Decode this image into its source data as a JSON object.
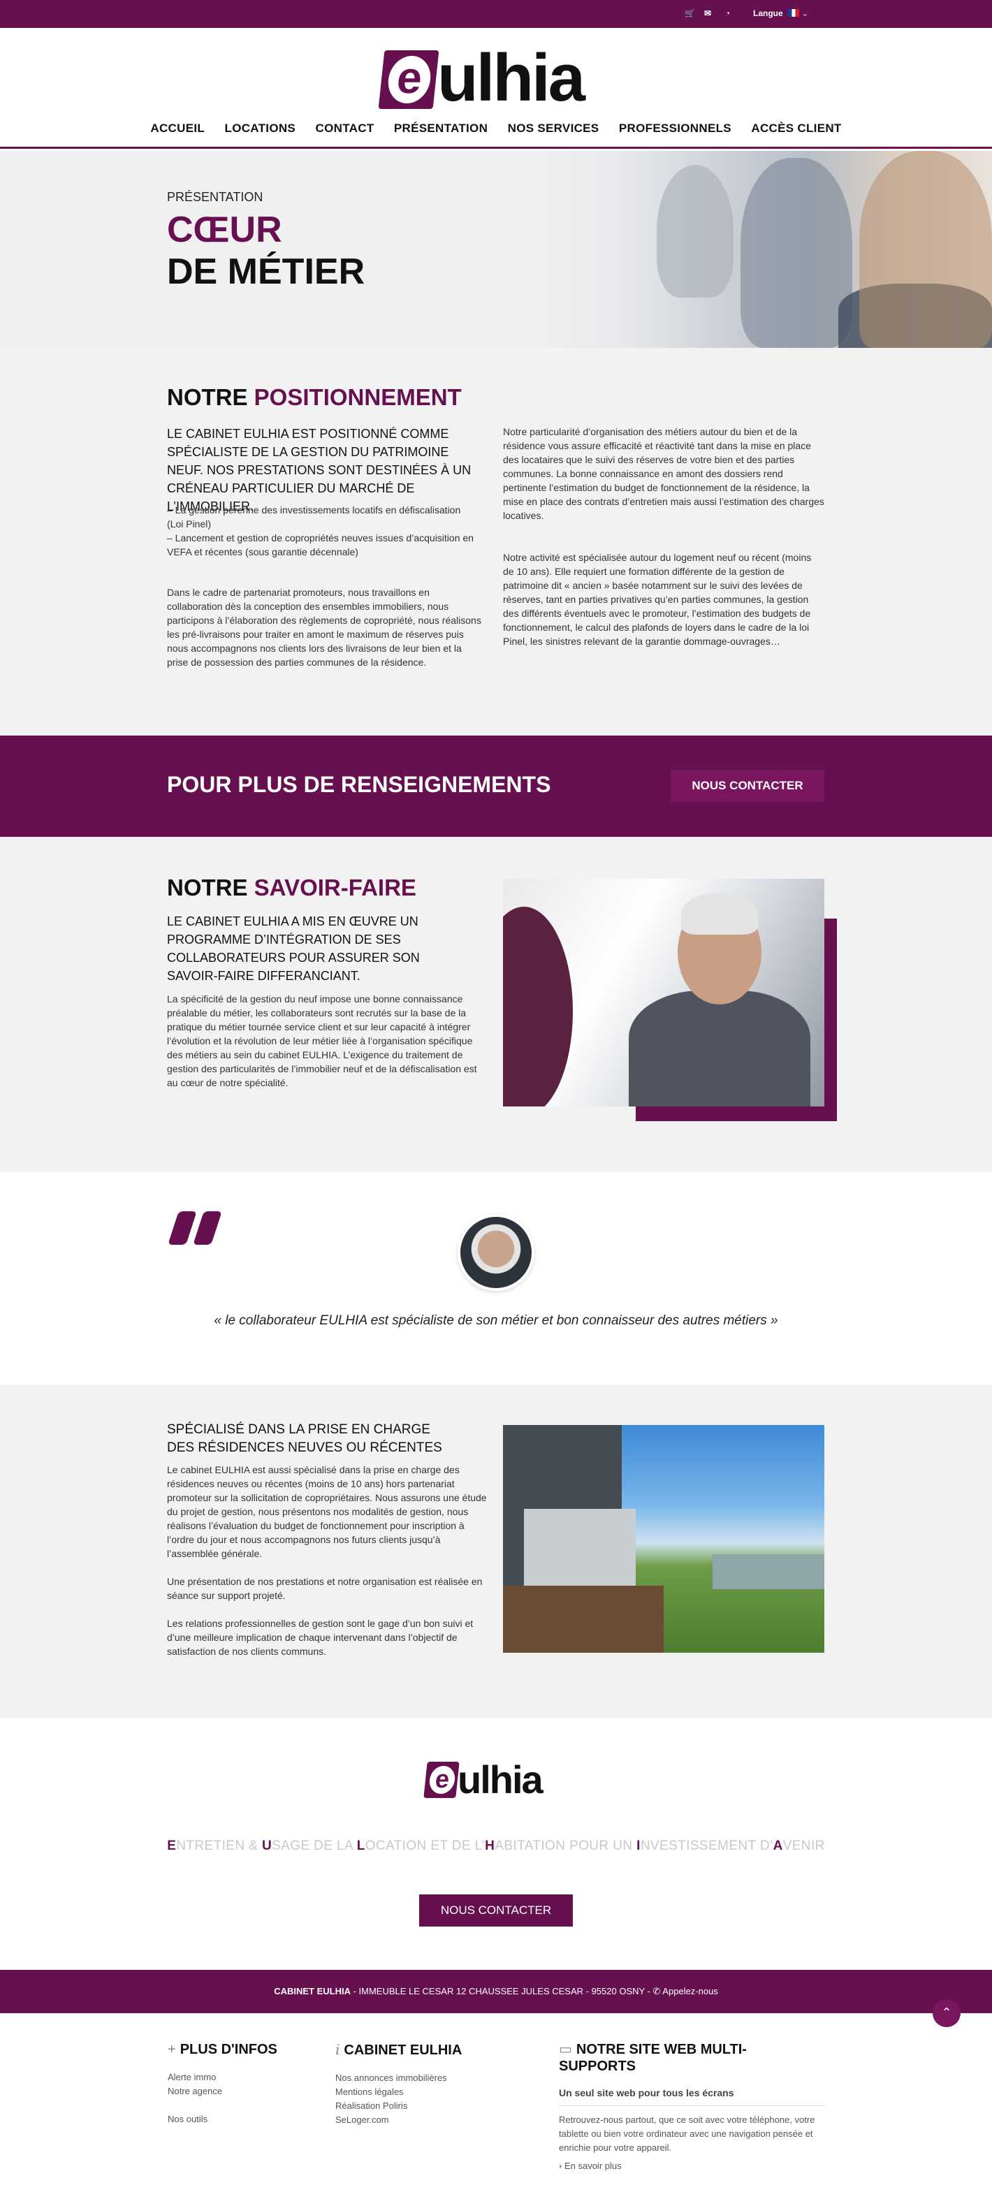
{
  "topbar": {
    "cart_icon": "cart-icon",
    "mail_icon": "mail-icon",
    "rss_icon": "rss-icon",
    "langue_label": "Langue",
    "langue_chevron": "⌄"
  },
  "header": {
    "logo_letter": "e",
    "logo_text": "ulhia",
    "nav": [
      "ACCUEIL",
      "LOCATIONS",
      "CONTACT",
      "PRÉSENTATION",
      "NOS SERVICES",
      "PROFESSIONNELS",
      "ACCÈS CLIENT"
    ]
  },
  "hero": {
    "kicker": "PRÉSENTATION",
    "title_line1": "CŒUR",
    "title_line2": "DE MÉTIER"
  },
  "positionnement": {
    "title_a": "NOTRE ",
    "title_b": "POSITIONNEMENT",
    "lead": "LE CABINET EULHIA EST POSITIONNÉ COMME SPÉCIALISTE DE LA GESTION DU PATRIMOINE NEUF. NOS PRESTATIONS SONT DESTINÉES À UN CRÉNEAU PARTICULIER DU MARCHÉ DE L’IMMOBILIER.",
    "bullets": "– La gestion pérenne des investissements locatifs en défiscalisation (Loi Pinel)\n– Lancement et gestion de copropriétés neuves issues d’acquisition en VEFA et récentes (sous garantie décennale)",
    "para_left": "Dans le cadre de partenariat promoteurs, nous travaillons en collaboration dès la conception des ensembles immobiliers, nous participons à l’élaboration des règlements de copropriété, nous réalisons les pré-livraisons pour traiter en amont le maximum de réserves puis nous accompagnons nos clients lors des livraisons de leur bien et la prise de possession des parties communes de la résidence.",
    "para_right_1": "Notre particularité d’organisation des métiers autour du bien et de la résidence vous assure efficacité et réactivité tant dans la mise en place des locataires que le suivi des réserves de votre bien et des parties communes. La bonne connaissance en amont des dossiers rend pertinente l’estimation du budget de fonctionnement de la résidence, la mise en place des contrats d’entretien mais aussi l’estimation des charges locatives.",
    "para_right_2": "Notre activité est spécialisée autour du logement neuf ou récent (moins de 10 ans). Elle requiert une formation différente de la gestion de patrimoine dit « ancien » basée notamment sur le suivi des levées de réserves, tant en parties privatives qu’en parties communes, la gestion des différents éventuels avec le promoteur, l’estimation des budgets de fonctionnement, le calcul des plafonds de loyers dans le cadre de la loi Pinel, les sinistres relevant de la garantie dommage-ouvrages…"
  },
  "cta": {
    "title": "POUR PLUS DE RENSEIGNEMENTS",
    "button": "NOUS CONTACTER"
  },
  "savoir": {
    "title_a": "NOTRE ",
    "title_b": "SAVOIR-FAIRE",
    "lead": "LE CABINET EULHIA A MIS EN ŒUVRE UN PROGRAMME D’INTÉGRATION DE SES COLLABORATEURS POUR ASSURER SON SAVOIR-FAIRE DIFFERANCIANT.",
    "body": "La spécificité de la gestion du neuf impose une bonne connaissance préalable du métier, les collaborateurs sont recrutés sur la base de la pratique du métier tournée service client et sur leur capacité à intégrer l’évolution et la révolution de leur métier liée à l’organisation spécifique des métiers au sein du cabinet EULHIA. L’exigence du traitement de gestion des particularités de l’immobilier neuf et de la défiscalisation est au cœur de notre spécialité."
  },
  "quote": {
    "text": "« le collaborateur EULHIA est spécialiste de son métier et bon connaisseur des autres métiers »"
  },
  "specialise": {
    "title": "SPÉCIALISÉ DANS LA PRISE EN CHARGE DES RÉSIDENCES NEUVES OU RÉCENTES",
    "para1": "Le cabinet EULHIA est aussi spécialisé dans la prise en charge des résidences neuves ou récentes (moins de 10 ans) hors partenariat promoteur sur la sollicitation de copropriétaires. Nous assurons une étude du projet de gestion, nous présentons nos modalités de gestion, nous réalisons l’évaluation du budget de fonctionnement pour inscription à l’ordre du jour et nous accompagnons nos futurs clients jusqu’à l’assemblée générale.",
    "para2": "Une présentation de nos prestations et notre organisation est réalisée en séance sur support projeté.",
    "para3": "Les relations professionnelles de gestion sont le gage d’un bon suivi et d’une meilleure implication de chaque intervenant dans l’objectif de satisfaction de nos clients communs."
  },
  "footlogo": {
    "logo_letter": "e",
    "logo_text": "ulhia",
    "tagline": [
      {
        "b": "E",
        "t": "NTRETIEN & "
      },
      {
        "b": "U",
        "t": "SAGE DE LA "
      },
      {
        "b": "L",
        "t": "OCATION ET DE L’"
      },
      {
        "b": "H",
        "t": "ABITATION POUR UN "
      },
      {
        "b": "I",
        "t": "NVESTISSEMENT D’"
      },
      {
        "b": "A",
        "t": "VENIR"
      }
    ],
    "button": "NOUS CONTACTER"
  },
  "address": {
    "company": "CABINET EULHIA",
    "text": " - IMMEUBLE LE CESAR 12 CHAUSSEE JULES CESAR - 95520 OSNY - ",
    "phone_icon": "phone-icon",
    "phone_label": "Appelez-nous"
  },
  "footer": {
    "col1": {
      "icon": "+",
      "title": "PLUS D'INFOS",
      "links": [
        "Alerte immo",
        "Notre agence",
        "",
        "Nos outils"
      ]
    },
    "col2": {
      "icon": "i",
      "title": "CABINET EULHIA",
      "links": [
        "Nos annonces immobilières",
        "Mentions légales",
        "Réalisation Poliris",
        "SeLoger.com"
      ]
    },
    "col3": {
      "icon": "▭",
      "title": "NOTRE SITE WEB MULTI-SUPPORTS",
      "subtitle": "Un seul site web pour tous les écrans",
      "text": "Retrouvez-nous partout, que ce soit avec votre téléphone, votre tablette ou bien votre ordinateur avec une navigation pensée et enrichie pour votre appareil.",
      "more": "En savoir plus"
    },
    "totop_icon": "chevron-up-icon"
  },
  "colors": {
    "brand": "#66104f",
    "grey_bg": "#f2f2f2"
  }
}
